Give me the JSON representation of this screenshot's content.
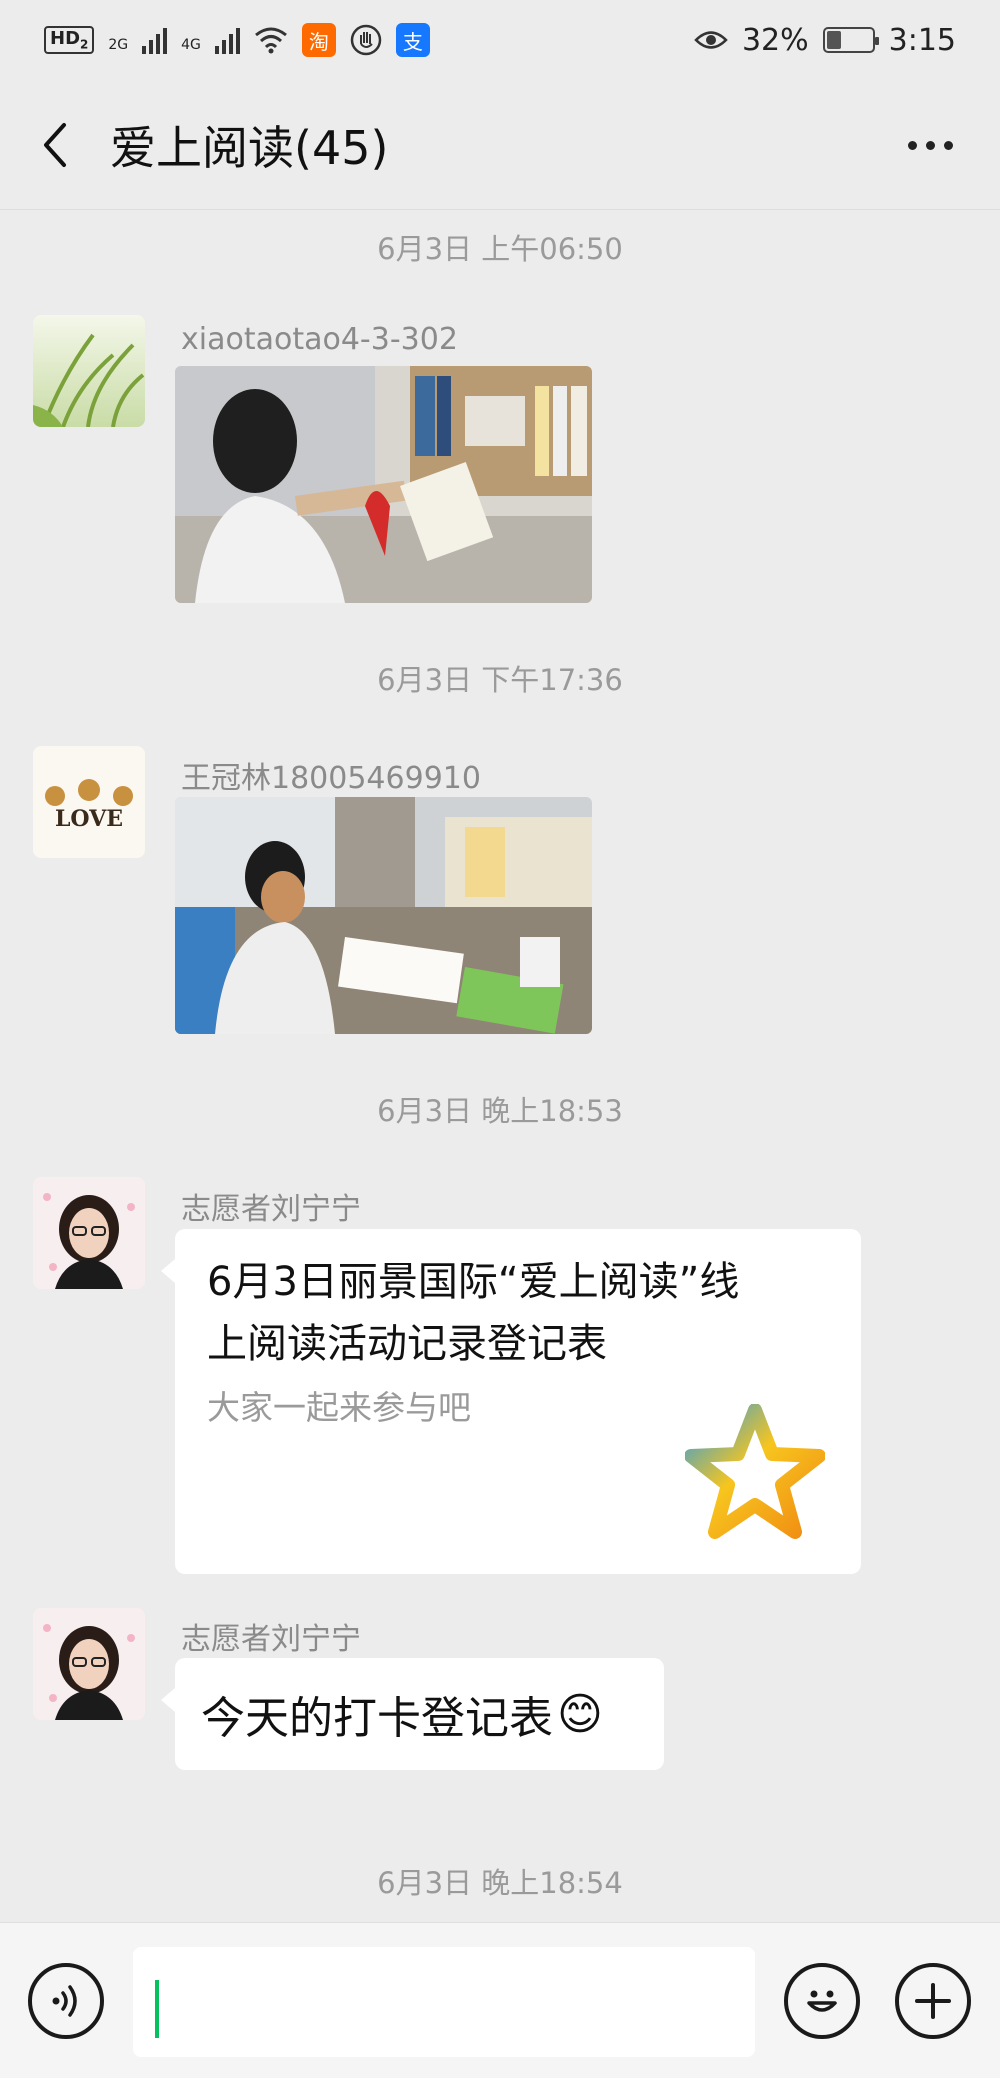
{
  "status_bar": {
    "hd_label": "HD",
    "hd_sub": "2",
    "net1": "2G",
    "net2": "4G",
    "taobao_label": "淘",
    "alipay_label": "支",
    "battery_percent": "32%",
    "battery_level": 0.32,
    "time": "3:15"
  },
  "header": {
    "title": "爱上阅读(45)"
  },
  "messages": {
    "ts1": "6月3日 上午06:50",
    "m1": {
      "sender": "xiaotaotao4-3-302"
    },
    "ts2": "6月3日 下午17:36",
    "m2": {
      "sender": "王冠林18005469910",
      "avatar_text": "LOVE"
    },
    "ts3": "6月3日 晚上18:53",
    "m3": {
      "sender": "志愿者刘宁宁",
      "card_title_line1": "6月3日丽景国际“爱上阅读”线",
      "card_title_line2": "上阅读活动记录登记表",
      "card_desc": "大家一起来参与吧"
    },
    "m4": {
      "sender": "志愿者刘宁宁",
      "text": "今天的打卡登记表",
      "emoji": "😊"
    },
    "ts4": "6月3日 晚上18:54"
  },
  "input_bar": {
    "text_value": ""
  },
  "colors": {
    "background": "#ececec",
    "bubble": "#ffffff",
    "caret": "#07c160",
    "timestamp": "#9a9a9a"
  },
  "icons": [
    "back-arrow-icon",
    "more-icon",
    "voice-icon",
    "emoji-icon",
    "plus-icon",
    "star-icon",
    "eye-icon",
    "wifi-icon"
  ]
}
